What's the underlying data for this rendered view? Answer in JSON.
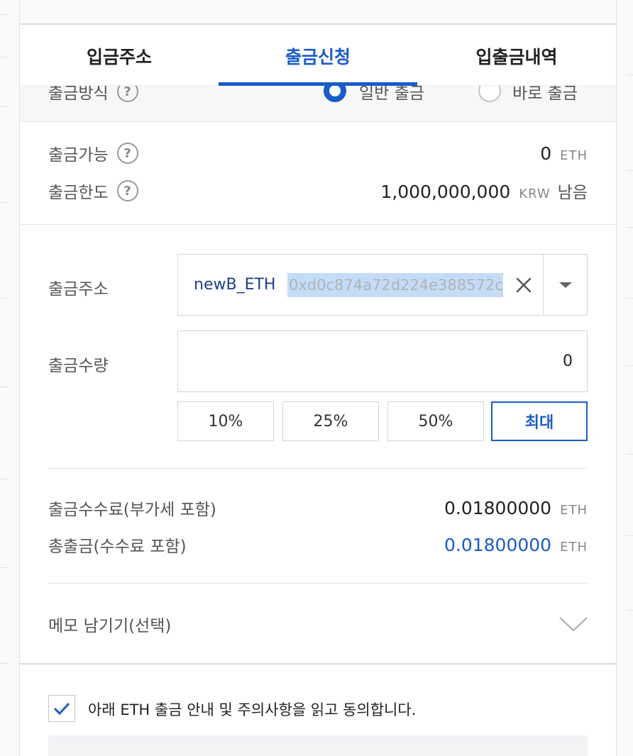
{
  "tabs": [
    {
      "label": "입금주소",
      "active": false
    },
    {
      "label": "출금신청",
      "active": true
    },
    {
      "label": "입출금내역",
      "active": false
    }
  ],
  "method": {
    "label": "출금방식",
    "options": [
      {
        "label": "일반 출금",
        "selected": true
      },
      {
        "label": "바로 출금",
        "selected": false
      }
    ]
  },
  "available": {
    "label": "출금가능",
    "value": "0",
    "unit": "ETH"
  },
  "limit": {
    "label": "출금한도",
    "value": "1,000,000,000",
    "unit": "KRW",
    "suffix": "남음"
  },
  "address": {
    "label": "출금주소",
    "nickname": "newB_ETH",
    "value": "0xd0c874a72d224e388572c"
  },
  "amount": {
    "label": "출금수량",
    "value": "0"
  },
  "percent_buttons": [
    "10%",
    "25%",
    "50%",
    "최대"
  ],
  "fee": {
    "label": "출금수수료(부가세 포함)",
    "value": "0.01800000",
    "unit": "ETH"
  },
  "total": {
    "label": "총출금(수수료 포함)",
    "value": "0.01800000",
    "unit": "ETH"
  },
  "memo": {
    "label": "메모 남기기(선택)"
  },
  "agree": {
    "text": "아래 ETH 출금 안내 및 주의사항을 읽고 동의합니다.",
    "checked": true
  },
  "notice": {
    "text": ""
  },
  "colors": {
    "accent": "#1a5cc8",
    "selection": "#c4dcf7"
  },
  "icons": {
    "help": "?",
    "clear": "×",
    "check": "checkmark-icon"
  }
}
